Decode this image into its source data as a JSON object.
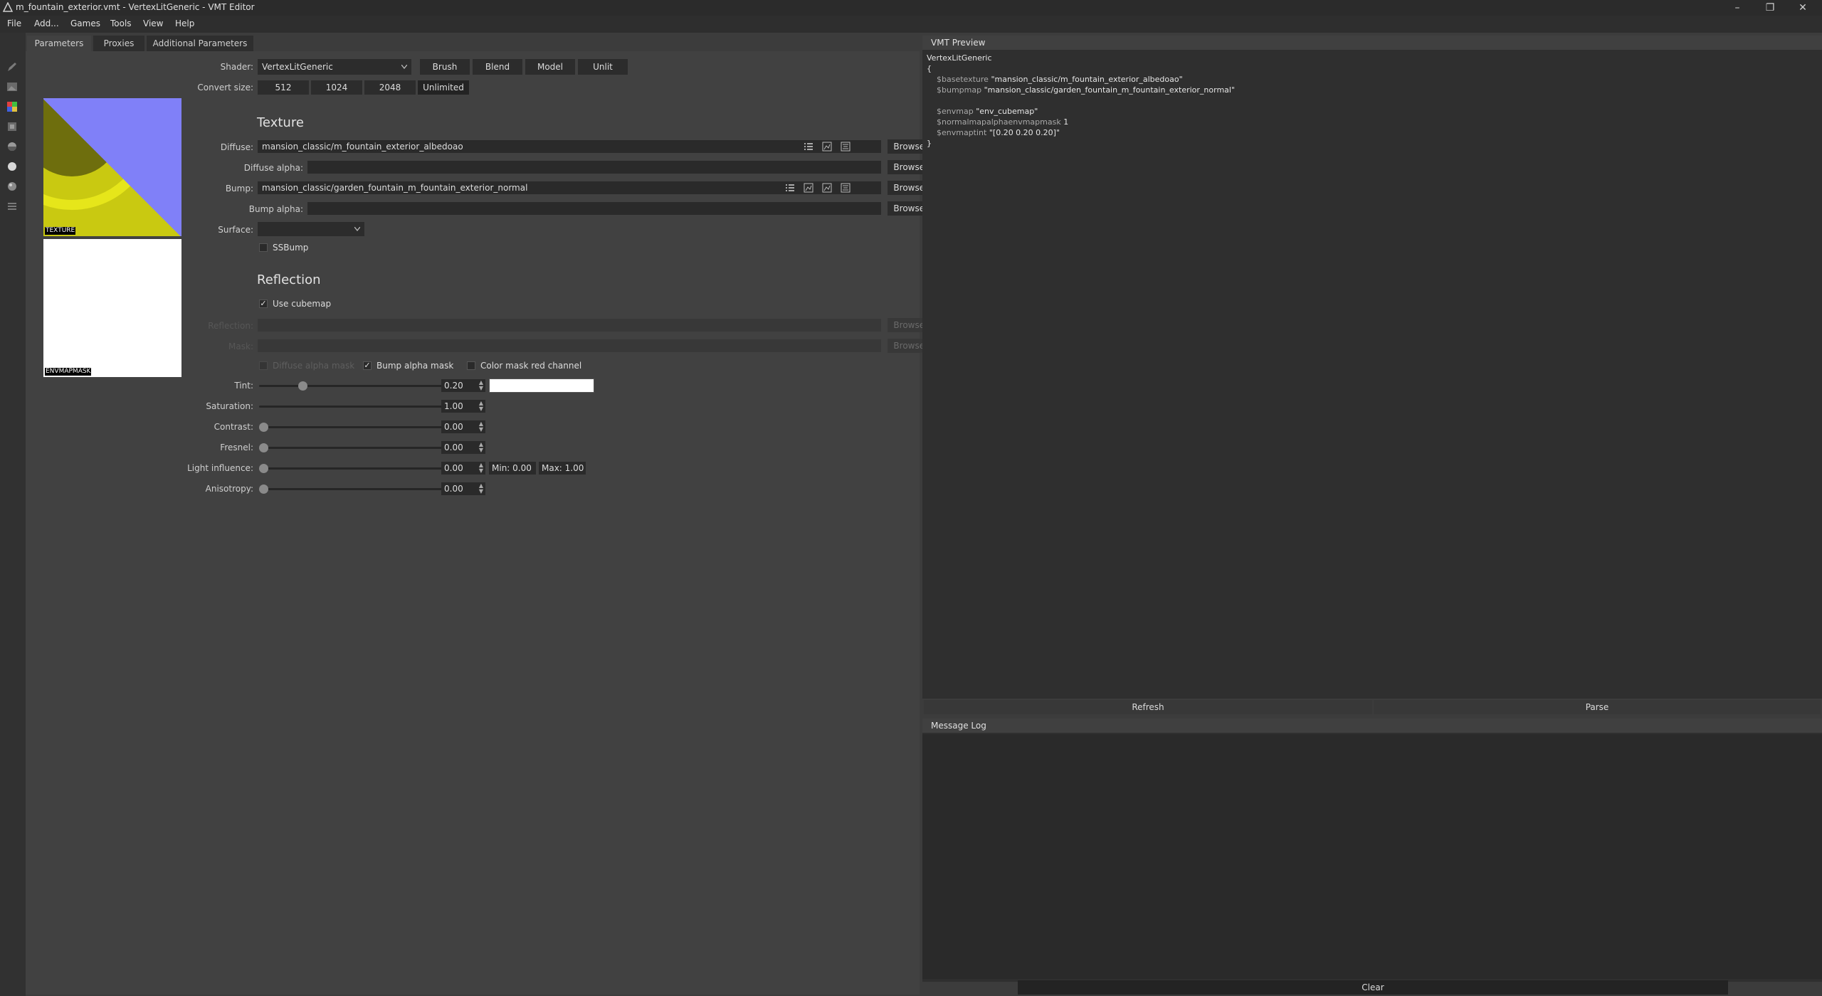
{
  "window": {
    "title": "m_fountain_exterior.vmt - VertexLitGeneric - VMT Editor",
    "controls": [
      "minimize",
      "restore",
      "close"
    ]
  },
  "menu": [
    "File",
    "Add...",
    "Games",
    "Tools",
    "View",
    "Help"
  ],
  "tabs": [
    "Parameters",
    "Proxies",
    "Additional Parameters"
  ],
  "shader": {
    "label": "Shader:",
    "value": "VertexLitGeneric",
    "buttons": [
      "Brush",
      "Blend",
      "Model",
      "Unlit"
    ]
  },
  "convert": {
    "label": "Convert size:",
    "sizes": [
      "512",
      "1024",
      "2048",
      "Unlimited"
    ]
  },
  "previews": {
    "texture_caption": "TEXTURE",
    "envmask_caption": "ENVMAPMASK",
    "texture_colors": {
      "diffuse": "#d4d40e",
      "normal": "#8080f8",
      "shadow": "#5f5f0a"
    }
  },
  "texture_section": {
    "title": "Texture",
    "diffuse_label": "Diffuse:",
    "diffuse_value": "mansion_classic/m_fountain_exterior_albedoao",
    "diffuse_alpha_label": "Diffuse alpha:",
    "diffuse_alpha_value": "",
    "bump_label": "Bump:",
    "bump_value": "mansion_classic/garden_fountain_m_fountain_exterior_normal",
    "bump_alpha_label": "Bump alpha:",
    "bump_alpha_value": "",
    "browse": "Browse...",
    "surface_label": "Surface:",
    "surface_value": "",
    "ssbump_label": "SSBump",
    "field_icons": [
      "list-icon",
      "edit-image-icon",
      "image-resize-icon",
      "swap-icon"
    ]
  },
  "reflection_section": {
    "title": "Reflection",
    "use_cubemap_label": "Use cubemap",
    "use_cubemap_checked": true,
    "cubemap_label": "Reflection:",
    "mask_label": "Mask:",
    "diffuse_alpha_mask_label": "Diffuse alpha mask",
    "bump_alpha_mask_label": "Bump alpha mask",
    "bump_alpha_mask_checked": true,
    "color_mask_label": "Color mask red channel",
    "color_mask_checked": false,
    "browse": "Browse..."
  },
  "sliders": [
    {
      "label": "Tint:",
      "value": "0.20",
      "level": 0.2
    },
    {
      "label": "Saturation:",
      "value": "1.00",
      "level": 1.0
    },
    {
      "label": "Contrast:",
      "value": "0.00",
      "level": 0.0
    },
    {
      "label": "Fresnel:",
      "value": "0.00",
      "level": 0.0
    },
    {
      "label": "Light influence:",
      "value": "0.00",
      "level": 0.0
    },
    {
      "label": "Anisotropy:",
      "value": "0.00",
      "level": 0.0
    }
  ],
  "tint_color": "#ffffff",
  "light_influence": {
    "min": "Min: 0.00",
    "max": "Max: 1.00"
  },
  "vmt_preview": {
    "title": "VMT Preview",
    "shader_line": "VertexLitGeneric",
    "open_brace": "{",
    "close_brace": "}",
    "params": [
      {
        "key": "$basetexture",
        "value": "\"mansion_classic/m_fountain_exterior_albedoao\""
      },
      {
        "key": "$bumpmap",
        "value": "\"mansion_classic/garden_fountain_m_fountain_exterior_normal\""
      },
      {
        "key": "",
        "value": ""
      },
      {
        "key": "$envmap",
        "value": "\"env_cubemap\""
      },
      {
        "key": "$normalmapalphaenvmapmask",
        "value": "1"
      },
      {
        "key": "$envmaptint",
        "value": "\"[0.20 0.20 0.20]\""
      }
    ],
    "refresh": "Refresh",
    "parse": "Parse"
  },
  "message_log": {
    "title": "Message Log",
    "clear": "Clear"
  }
}
